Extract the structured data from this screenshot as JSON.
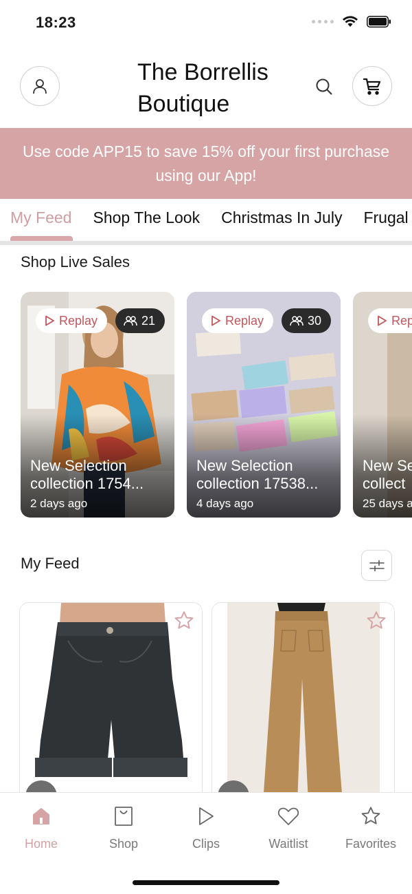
{
  "status_bar": {
    "time": "18:23"
  },
  "header": {
    "title_line1": "The Borrellis",
    "title_line2": "Boutique",
    "icons": [
      "user-icon",
      "search-icon",
      "cart-icon"
    ]
  },
  "promo": {
    "text": "Use code APP15 to save 15% off your first purchase using our App!"
  },
  "tabs": [
    {
      "label": "My Feed",
      "active": true
    },
    {
      "label": "Shop The Look"
    },
    {
      "label": "Christmas In July"
    },
    {
      "label": "Frugal"
    }
  ],
  "live_sales": {
    "heading": "Shop Live Sales",
    "replay_label": "Replay",
    "cards": [
      {
        "viewers": "21",
        "title_line1": "New Selection",
        "title_line2": "collection 1754...",
        "time": "2 days ago"
      },
      {
        "viewers": "30",
        "title_line1": "New Selection",
        "title_line2": "collection 17538...",
        "time": "4 days ago"
      },
      {
        "viewers": "",
        "title_line1": "New Se",
        "title_line2": "collect",
        "time": "25 days a"
      }
    ]
  },
  "feed": {
    "heading": "My Feed",
    "products": [
      {
        "name": "black-denim-shorts"
      },
      {
        "name": "tan-wide-leg-pants"
      }
    ]
  },
  "bottom_nav": [
    {
      "label": "Home",
      "icon": "home-icon",
      "active": true
    },
    {
      "label": "Shop",
      "icon": "shopping-bag-icon"
    },
    {
      "label": "Clips",
      "icon": "play-icon"
    },
    {
      "label": "Waitlist",
      "icon": "heart-icon"
    },
    {
      "label": "Favorites",
      "icon": "star-icon"
    }
  ],
  "colors": {
    "accent": "#d7a4a6",
    "accent_text": "#cf9ea0",
    "replay_text": "#c0575c"
  }
}
